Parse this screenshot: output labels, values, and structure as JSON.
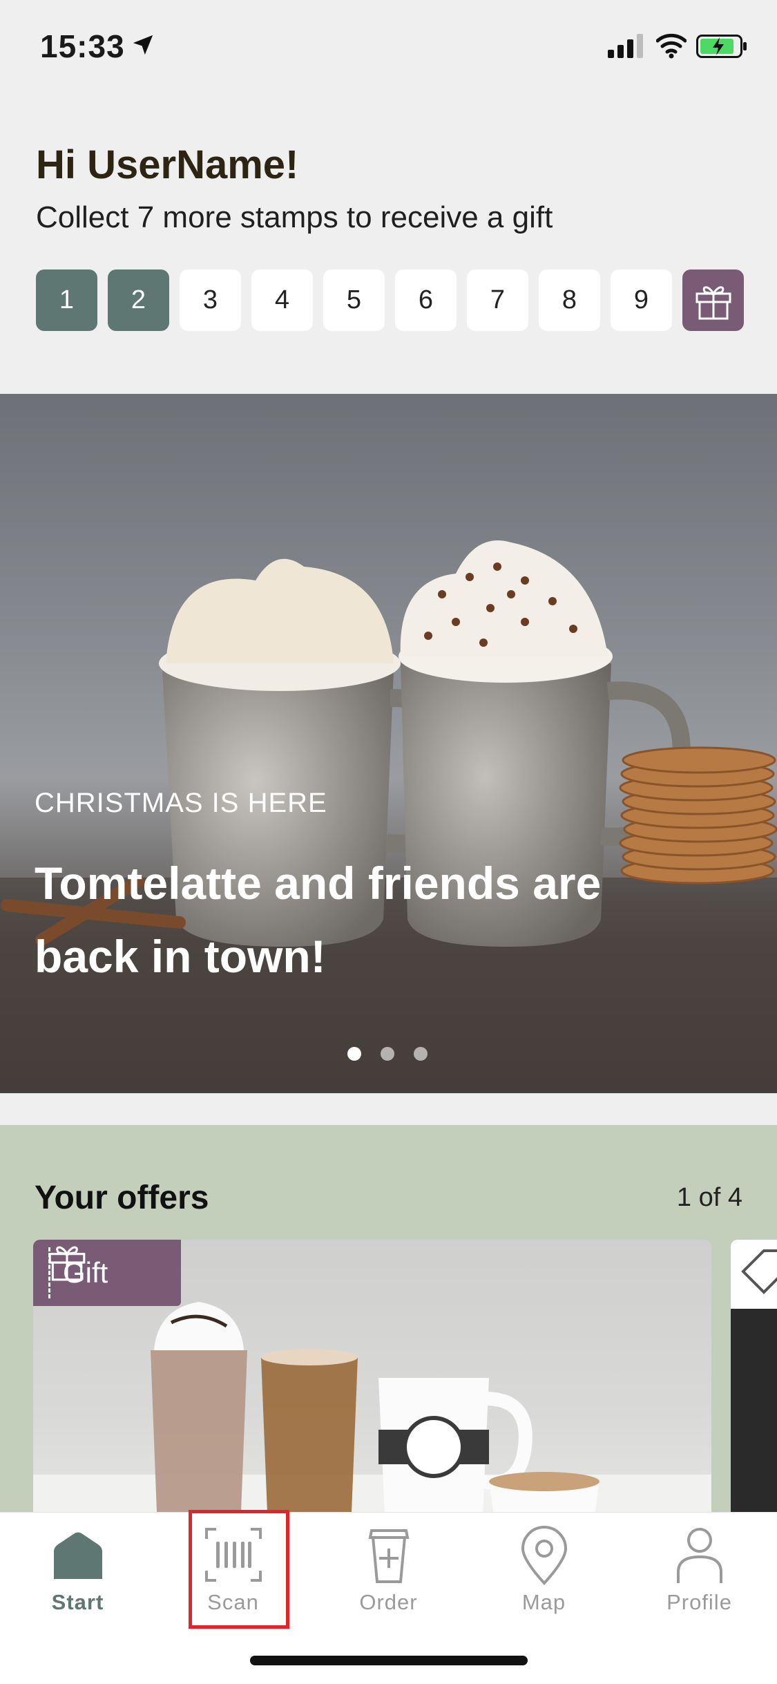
{
  "status_bar": {
    "time": "15:33"
  },
  "greeting": {
    "title": "Hi UserName!",
    "subtitle": "Collect 7 more stamps to receive a gift"
  },
  "stamps": {
    "items": [
      "1",
      "2",
      "3",
      "4",
      "5",
      "6",
      "7",
      "8",
      "9"
    ],
    "filled_count": 2,
    "reward_icon": "gift-icon"
  },
  "hero": {
    "kicker": "CHRISTMAS IS HERE",
    "title": "Tomtelatte and friends are back in town!",
    "slides": 3,
    "active_slide": 1
  },
  "offers": {
    "title": "Your offers",
    "count": "1 of 4",
    "card_tag": "Gift"
  },
  "tabbar": {
    "tabs": [
      {
        "label": "Start",
        "icon": "home-icon",
        "active": true
      },
      {
        "label": "Scan",
        "icon": "barcode-scan-icon",
        "active": false
      },
      {
        "label": "Order",
        "icon": "cup-plus-icon",
        "active": false
      },
      {
        "label": "Map",
        "icon": "map-pin-icon",
        "active": false
      },
      {
        "label": "Profile",
        "icon": "profile-icon",
        "active": false
      }
    ]
  },
  "colors": {
    "stamp_filled": "#5f7772",
    "gift_accent": "#7a5b75",
    "offers_bg": "#c3cfbb",
    "highlight": "#e0262c"
  }
}
